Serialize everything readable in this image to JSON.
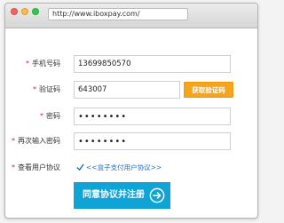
{
  "browser": {
    "url": "http://www.iboxpay.com/"
  },
  "form": {
    "phone": {
      "label": "手机号码",
      "value": "13699850570"
    },
    "code": {
      "label": "验证码",
      "value": "643007",
      "button": "获取验证码"
    },
    "password": {
      "label": "密码",
      "value": "••••••••"
    },
    "password_confirm": {
      "label": "再次输入密码",
      "value": "••••••••"
    },
    "agreement": {
      "label": "查看用户协议",
      "link": "<<盒子支付用户协议>>",
      "checked": true
    },
    "submit_label": "同意协议并注册"
  },
  "colors": {
    "required": "#d9262c",
    "accent_orange": "#f4a51c",
    "submit_blue": "#0ea5d6",
    "link_blue": "#1e6fd9"
  },
  "icons": {
    "submit": "circle-arrow-right-icon",
    "checkbox": "checkmark-icon"
  }
}
